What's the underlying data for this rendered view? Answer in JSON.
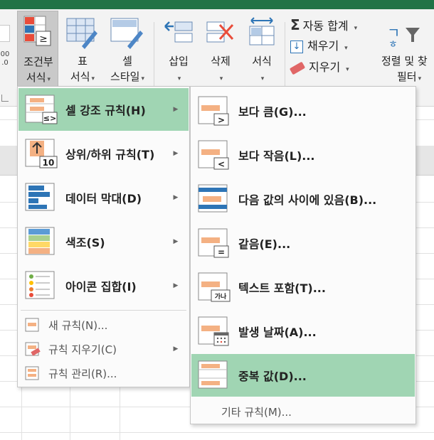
{
  "ribbon": {
    "cond_format": {
      "line1": "조건부",
      "line2": "서식"
    },
    "table_format": {
      "line1": "표",
      "line2": "서식"
    },
    "cell_style": {
      "line1": "셀",
      "line2": "스타일"
    },
    "insert": {
      "label": "삽입"
    },
    "delete": {
      "label": "삭제"
    },
    "format": {
      "label": "서식"
    },
    "autosum": "자동 합계",
    "fill": "채우기",
    "clear": "지우기",
    "sort_filter": {
      "line1": "정렬 및 찾",
      "line2": "필터"
    },
    "number_partial": "00\n.0"
  },
  "main_menu": {
    "items": [
      {
        "label": "셀 강조 규칙(H)",
        "hot": "H"
      },
      {
        "label": "상위/하위 규칙(T)",
        "hot": "T"
      },
      {
        "label": "데이터 막대(D)",
        "hot": "D"
      },
      {
        "label": "색조(S)",
        "hot": "S"
      },
      {
        "label": "아이콘 집합(I)",
        "hot": "I"
      }
    ],
    "small_items": [
      {
        "label": "새 규칙(N)..."
      },
      {
        "label": "규칙 지우기(C)"
      },
      {
        "label": "규칙 관리(R)..."
      }
    ]
  },
  "sub_menu": {
    "items": [
      {
        "label": "보다 큼(G)..."
      },
      {
        "label": "보다 작음(L)..."
      },
      {
        "label": "다음 값의 사이에 있음(B)..."
      },
      {
        "label": "같음(E)..."
      },
      {
        "label": "텍스트 포함(T)..."
      },
      {
        "label": "발생 날짜(A)..."
      },
      {
        "label": "중복 값(D)..."
      }
    ],
    "more": "기타 규칙(M)..."
  },
  "icon_text": {
    "ge": "≥",
    "ten": "10",
    "ganai": "가나"
  },
  "colors": {
    "selected": "#a0d5b3",
    "accent": "#217346",
    "orange": "#f4b183",
    "blue": "#2e75b6"
  }
}
